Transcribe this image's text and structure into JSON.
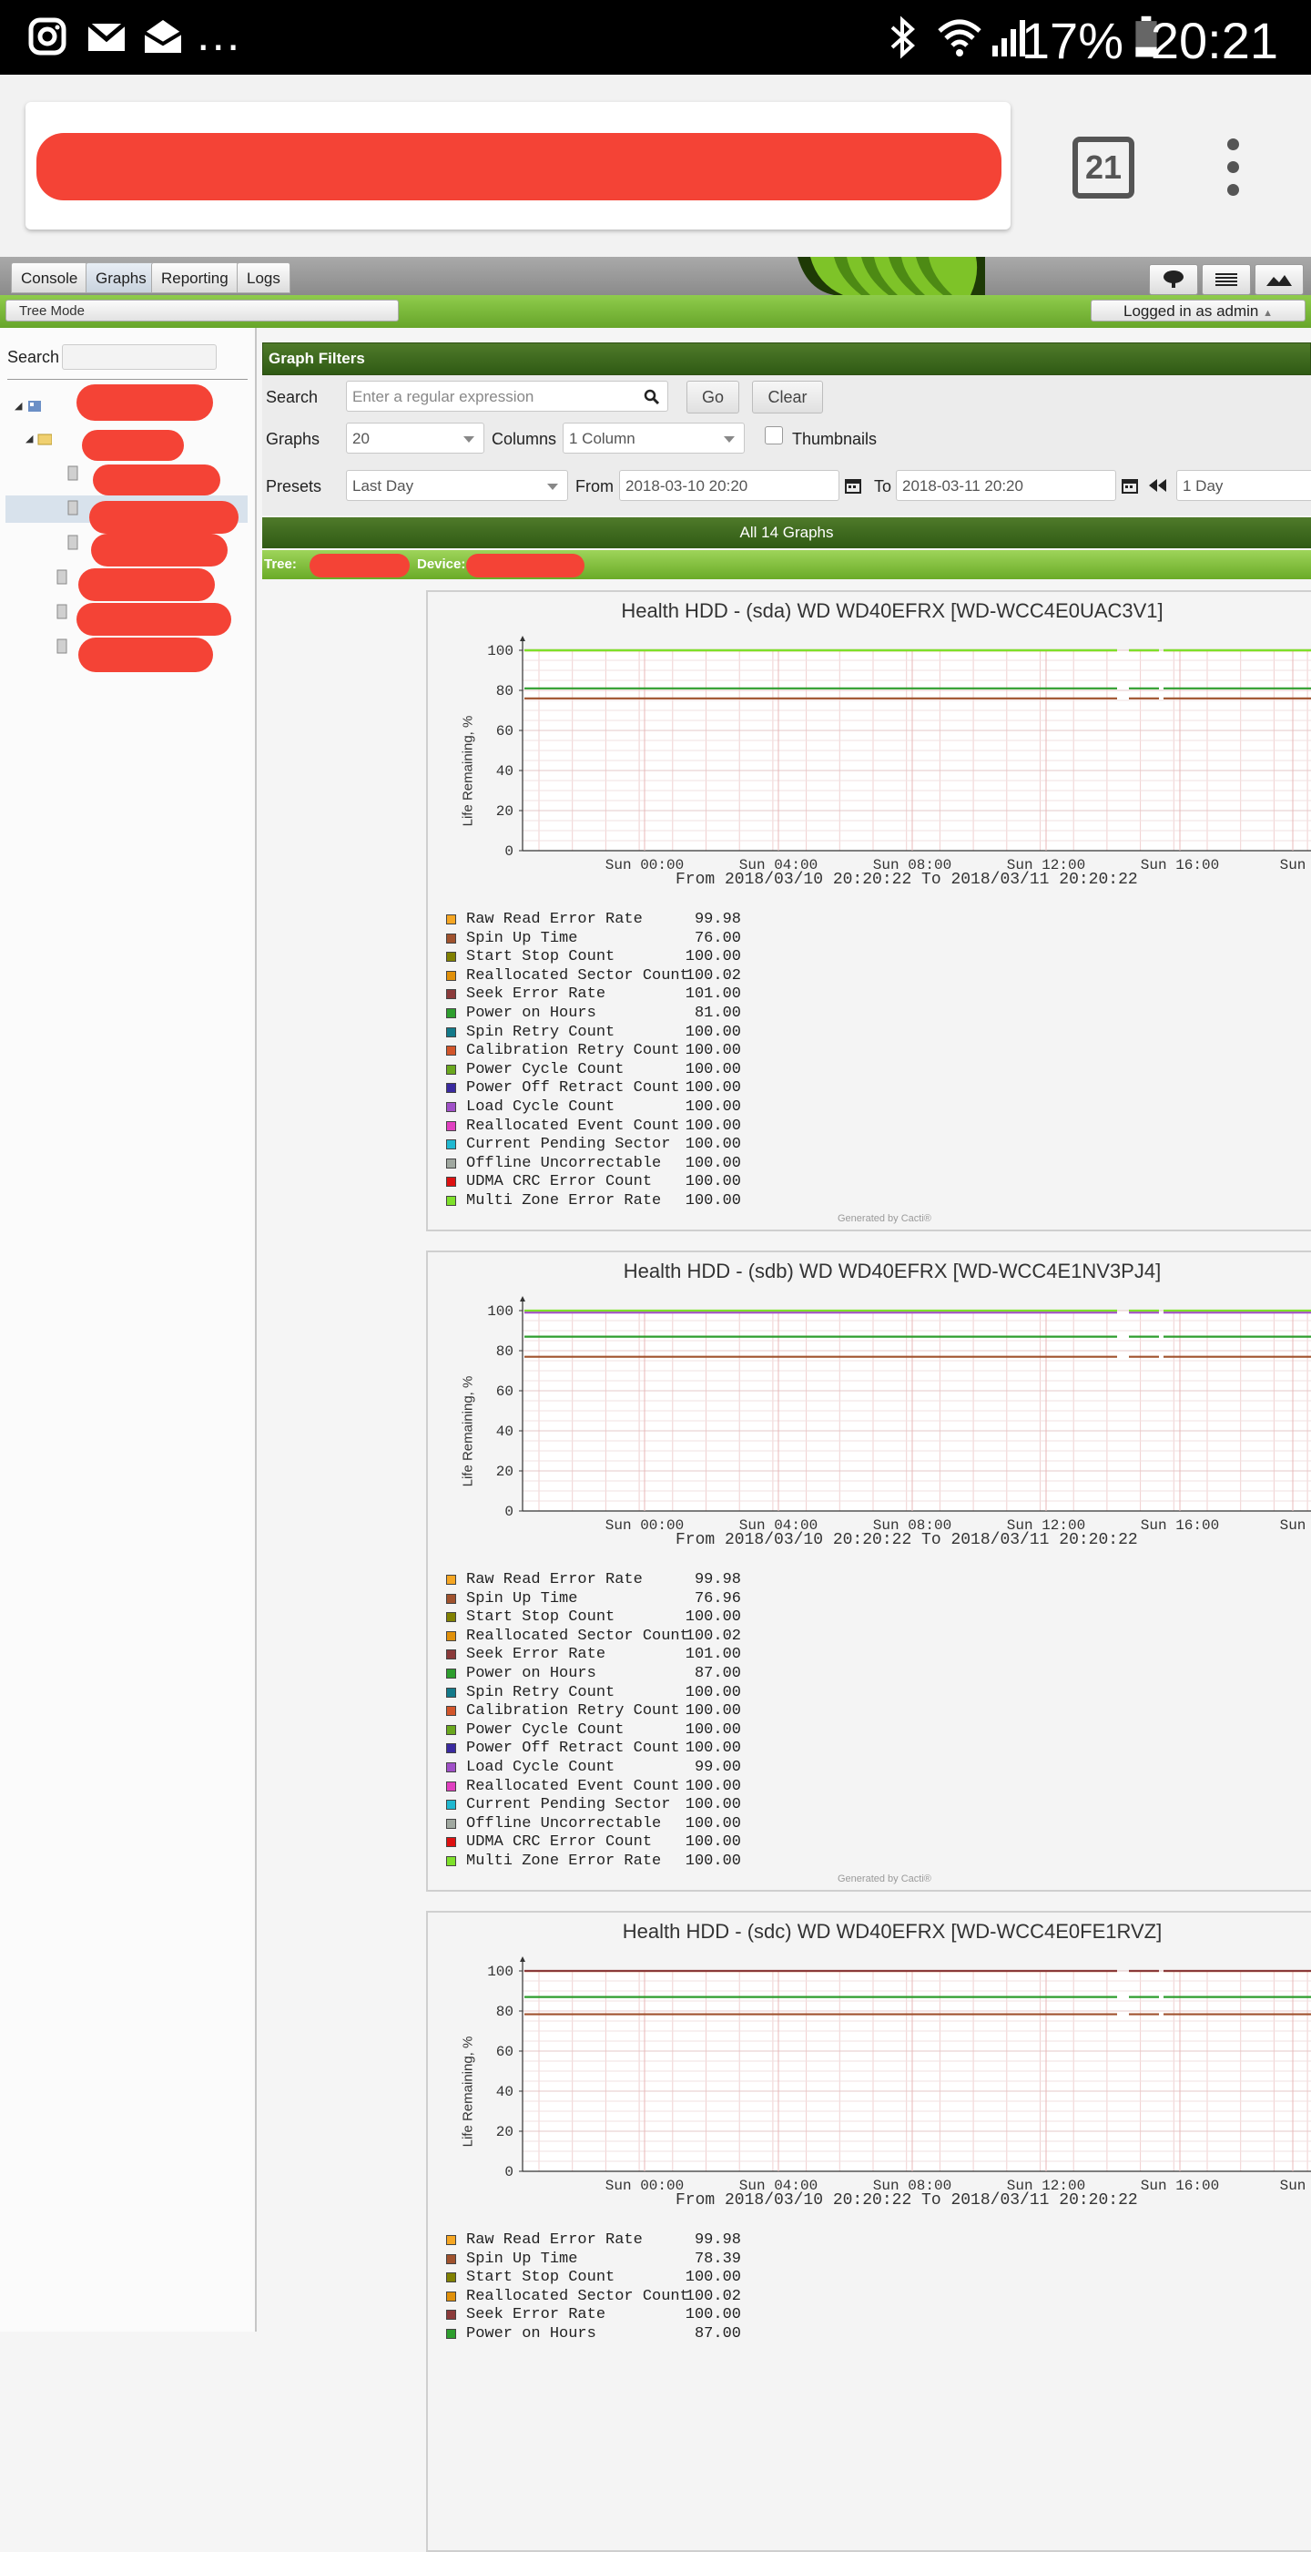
{
  "status_bar": {
    "time": "20:21",
    "battery_percent": "17%",
    "notification_icons": [
      "instagram-icon",
      "gmail-icon",
      "envelope-icon",
      "more-icon"
    ],
    "more_label": "..."
  },
  "browser": {
    "tab_count": "21"
  },
  "cacti_nav": {
    "tabs": [
      "Console",
      "Graphs",
      "Reporting",
      "Logs"
    ],
    "selected_tab": "Graphs",
    "breadcrumb": "Tree Mode",
    "logged_in": "Logged in as admin"
  },
  "tree": {
    "search_label": "Search"
  },
  "filters": {
    "header": "Graph Filters",
    "search_label": "Search",
    "search_placeholder": "Enter a regular expression",
    "go_label": "Go",
    "clear_label": "Clear",
    "graphs_label": "Graphs",
    "graphs_value": "20",
    "columns_label": "Columns",
    "columns_value": "1 Column",
    "thumbnails_label": "Thumbnails",
    "presets_label": "Presets",
    "presets_value": "Last Day",
    "from_label": "From",
    "from_value": "2018-03-10 20:20",
    "to_label": "To",
    "to_value": "2018-03-11 20:20",
    "timespan_value": "1 Day"
  },
  "summary": {
    "all_graphs": "All 14 Graphs",
    "tree_label": "Tree:",
    "device_label": "Device:"
  },
  "graphs": [
    {
      "title": "Health HDD - (sda) WD WD40EFRX [WD-WCC4E0UAC3V1]",
      "ylabel": "Life Remaining, %",
      "yticks": [
        "100",
        "80",
        "60",
        "40",
        "20",
        "0"
      ],
      "xticks": [
        "Sun 00:00",
        "Sun 04:00",
        "Sun 08:00",
        "Sun 12:00",
        "Sun 16:00",
        "Sun"
      ],
      "from_to": "From 2018/03/10 20:20:22 To 2018/03/11 20:20:22",
      "legend_values": [
        "99.98",
        "76.00",
        "100.00",
        "100.02",
        "101.00",
        "81.00",
        "100.00",
        "100.00",
        "100.00",
        "100.00",
        "100.00",
        "100.00",
        "100.00",
        "100.00",
        "100.00",
        "100.00"
      ],
      "generated": "Generated by Cacti®"
    },
    {
      "title": "Health HDD - (sdb) WD WD40EFRX [WD-WCC4E1NV3PJ4]",
      "ylabel": "Life Remaining, %",
      "yticks": [
        "100",
        "80",
        "60",
        "40",
        "20",
        "0"
      ],
      "xticks": [
        "Sun 00:00",
        "Sun 04:00",
        "Sun 08:00",
        "Sun 12:00",
        "Sun 16:00",
        "Sun"
      ],
      "from_to": "From 2018/03/10 20:20:22 To 2018/03/11 20:20:22",
      "legend_values": [
        "99.98",
        "76.96",
        "100.00",
        "100.02",
        "101.00",
        "87.00",
        "100.00",
        "100.00",
        "100.00",
        "100.00",
        "99.00",
        "100.00",
        "100.00",
        "100.00",
        "100.00",
        "100.00"
      ],
      "generated": "Generated by Cacti®"
    },
    {
      "title": "Health HDD - (sdc) WD WD40EFRX [WD-WCC4E0FE1RVZ]",
      "ylabel": "Life Remaining, %",
      "yticks": [
        "100",
        "80",
        "60",
        "40",
        "20",
        "0"
      ],
      "xticks": [
        "Sun 00:00",
        "Sun 04:00",
        "Sun 08:00",
        "Sun 12:00",
        "Sun 16:00",
        "Sun"
      ],
      "from_to": "From 2018/03/10 20:20:22 To 2018/03/11 20:20:22",
      "legend_values": [
        "99.98",
        "78.39",
        "100.00",
        "100.02",
        "100.00",
        "87.00"
      ],
      "generated": ""
    }
  ],
  "legend_names": [
    "Raw Read Error Rate",
    "Spin Up Time",
    "Start Stop Count",
    "Reallocated Sector Count",
    "Seek Error Rate",
    "Power on Hours",
    "Spin Retry Count",
    "Calibration Retry Count",
    "Power Cycle Count",
    "Power Off Retract Count",
    "Load Cycle Count",
    "Reallocated Event Count",
    "Current Pending Sector",
    "Offline Uncorrectable",
    "UDMA CRC Error Count",
    "Multi Zone Error Rate"
  ],
  "legend_colors": [
    "#f5a623",
    "#a0522d",
    "#808000",
    "#e0900a",
    "#8b3a3a",
    "#2e9e2e",
    "#137a8a",
    "#d2552a",
    "#6aa81e",
    "#3a2aa0",
    "#a050c8",
    "#e040c0",
    "#20b8d0",
    "#a0a8a0",
    "#dd1111",
    "#7ee02a"
  ],
  "chart_data": [
    {
      "type": "line",
      "title": "Health HDD - (sda) WD WD40EFRX [WD-WCC4E0UAC3V1]",
      "ylabel": "Life Remaining, %",
      "ylim": [
        0,
        100
      ],
      "x": [
        "Sun 00:00",
        "Sun 04:00",
        "Sun 08:00",
        "Sun 12:00",
        "Sun 16:00"
      ],
      "series": [
        {
          "name": "Raw Read Error Rate",
          "value": 99.98
        },
        {
          "name": "Spin Up Time",
          "value": 76.0
        },
        {
          "name": "Start Stop Count",
          "value": 100.0
        },
        {
          "name": "Power on Hours",
          "value": 81.0
        },
        {
          "name": "Multi Zone Error Rate",
          "value": 100.0
        }
      ]
    },
    {
      "type": "line",
      "title": "Health HDD - (sdb) WD WD40EFRX [WD-WCC4E1NV3PJ4]",
      "ylabel": "Life Remaining, %",
      "ylim": [
        0,
        100
      ],
      "x": [
        "Sun 00:00",
        "Sun 04:00",
        "Sun 08:00",
        "Sun 12:00",
        "Sun 16:00"
      ],
      "series": [
        {
          "name": "Raw Read Error Rate",
          "value": 99.98
        },
        {
          "name": "Spin Up Time",
          "value": 76.96
        },
        {
          "name": "Power on Hours",
          "value": 87.0
        },
        {
          "name": "Load Cycle Count",
          "value": 99.0
        },
        {
          "name": "Multi Zone Error Rate",
          "value": 100.0
        }
      ]
    },
    {
      "type": "line",
      "title": "Health HDD - (sdc) WD WD40EFRX [WD-WCC4E0FE1RVZ]",
      "ylabel": "Life Remaining, %",
      "ylim": [
        0,
        100
      ],
      "x": [
        "Sun 00:00",
        "Sun 04:00",
        "Sun 08:00",
        "Sun 12:00",
        "Sun 16:00"
      ],
      "series": [
        {
          "name": "Raw Read Error Rate",
          "value": 99.98
        },
        {
          "name": "Spin Up Time",
          "value": 78.39
        },
        {
          "name": "Power on Hours",
          "value": 87.0
        },
        {
          "name": "Seek Error Rate",
          "value": 100.0
        }
      ]
    }
  ]
}
